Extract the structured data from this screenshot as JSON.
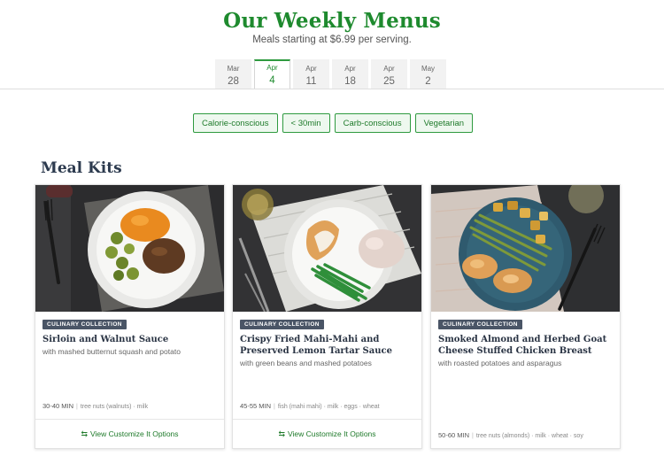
{
  "header": {
    "title": "Our Weekly Menus",
    "subtitle": "Meals starting at $6.99 per serving."
  },
  "dates": [
    {
      "month": "Mar",
      "day": "28",
      "active": false
    },
    {
      "month": "Apr",
      "day": "4",
      "active": true
    },
    {
      "month": "Apr",
      "day": "11",
      "active": false
    },
    {
      "month": "Apr",
      "day": "18",
      "active": false
    },
    {
      "month": "Apr",
      "day": "25",
      "active": false
    },
    {
      "month": "May",
      "day": "2",
      "active": false
    }
  ],
  "filters": [
    "Calorie-conscious",
    "< 30min",
    "Carb-conscious",
    "Vegetarian"
  ],
  "section": {
    "title": "Meal Kits"
  },
  "cards": [
    {
      "badge": "CULINARY COLLECTION",
      "title": "Sirloin and Walnut Sauce",
      "desc": "with mashed butternut squash and potato",
      "time": "30-40 MIN",
      "allergens": "tree nuts (walnuts) · milk",
      "cta": "View Customize It Options"
    },
    {
      "badge": "CULINARY COLLECTION",
      "title": "Crispy Fried Mahi-Mahi and Preserved Lemon Tartar Sauce",
      "desc": "with green beans and mashed potatoes",
      "time": "45-55 MIN",
      "allergens": "fish (mahi mahi) · milk · eggs · wheat",
      "cta": "View Customize It Options"
    },
    {
      "badge": "CULINARY COLLECTION",
      "title": "Smoked Almond and Herbed Goat Cheese Stuffed Chicken Breast",
      "desc": "with roasted potatoes and asparagus",
      "time": "50-60 MIN",
      "allergens": "tree nuts (almonds) · milk · wheat · soy",
      "cta": ""
    }
  ],
  "icons": {
    "cta_icon": "swap-arrows-icon"
  },
  "colors": {
    "brand_green": "#1e8a2e",
    "badge": "#4a5566",
    "heading": "#2c3a4e"
  }
}
